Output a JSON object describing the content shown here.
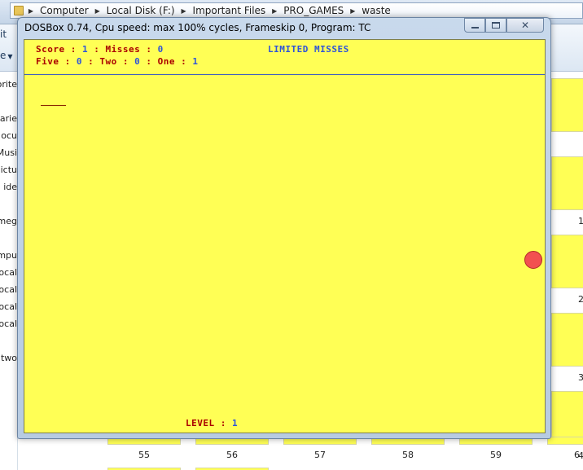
{
  "explorer": {
    "breadcrumb": [
      "Computer",
      "Local Disk (F:)",
      "Important Files",
      "PRO_GAMES",
      "waste"
    ],
    "toolbar_left_label": "it",
    "organize_label": "e",
    "nav_items": [
      "vorite",
      "rarie",
      "ocu",
      "Musi",
      "ictu",
      "ide",
      "meg",
      "mpu",
      "ocal",
      "ocal",
      "ocal",
      "ocal",
      "two"
    ],
    "thumbnail_numbers": [
      "55",
      "56",
      "57",
      "58",
      "59",
      "6"
    ],
    "right_edge_numbers": [
      "1",
      "2",
      "3",
      "4"
    ]
  },
  "dosbox": {
    "title": "DOSBox 0.74, Cpu speed: max 100% cycles, Frameskip  0, Program:      TC",
    "close_glyph": "✕"
  },
  "game": {
    "score_label": "Score : ",
    "score_value": "1",
    "misses_label": " : Misses : ",
    "misses_value": "0",
    "mode_text": "LIMITED MISSES",
    "five_label": "Five : ",
    "five_value": "0",
    "two_label": " : Two : ",
    "two_value": "0",
    "one_label": " : One : ",
    "one_value": "1",
    "level_label": "LEVEL : ",
    "level_value": "1"
  },
  "colors": {
    "game_background": "#ffff55",
    "label_red": "#aa0000",
    "value_blue": "#2e54d8",
    "ball": "#f25050"
  }
}
